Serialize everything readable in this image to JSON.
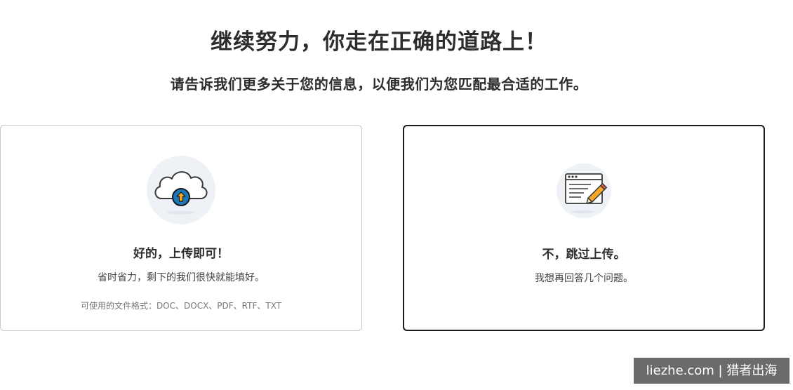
{
  "header": {
    "title": "继续努力，你走在正确的道路上！",
    "subtitle": "请告诉我们更多关于您的信息，以便我们为您匹配最合适的工作。"
  },
  "cards": {
    "upload": {
      "icon": "cloud-upload-icon",
      "heading": "好的，上传即可！",
      "description": "省时省力，剩下的我们很快就能填好。",
      "formats": "可使用的文件格式：DOC、DOCX、PDF、RTF、TXT"
    },
    "skip": {
      "icon": "document-pencil-icon",
      "heading": "不，跳过上传。",
      "description": "我想再回答几个问题。"
    }
  },
  "watermark": {
    "text": "liezhe.com | 猎者出海"
  },
  "colors": {
    "accent_blue": "#1b77b8",
    "arrow_orange": "#f5a623",
    "icon_bg": "#eef2f6"
  }
}
